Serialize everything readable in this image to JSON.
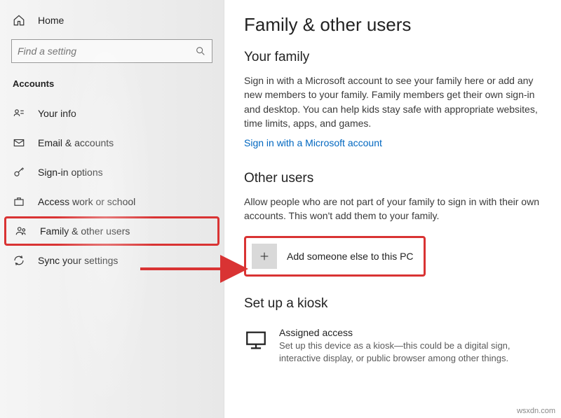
{
  "sidebar": {
    "home": "Home",
    "search_placeholder": "Find a setting",
    "section": "Accounts",
    "items": [
      {
        "label": "Your info"
      },
      {
        "label": "Email & accounts"
      },
      {
        "label": "Sign-in options"
      },
      {
        "label": "Access work or school"
      },
      {
        "label": "Family & other users"
      },
      {
        "label": "Sync your settings"
      }
    ]
  },
  "main": {
    "title": "Family & other users",
    "family": {
      "heading": "Your family",
      "desc": "Sign in with a Microsoft account to see your family here or add any new members to your family. Family members get their own sign-in and desktop. You can help kids stay safe with appropriate websites, time limits, apps, and games.",
      "link": "Sign in with a Microsoft account"
    },
    "other": {
      "heading": "Other users",
      "desc": "Allow people who are not part of your family to sign in with their own accounts. This won't add them to your family.",
      "add_label": "Add someone else to this PC"
    },
    "kiosk": {
      "heading": "Set up a kiosk",
      "title": "Assigned access",
      "desc": "Set up this device as a kiosk—this could be a digital sign, interactive display, or public browser among other things."
    }
  },
  "watermark": "wsxdn.com"
}
